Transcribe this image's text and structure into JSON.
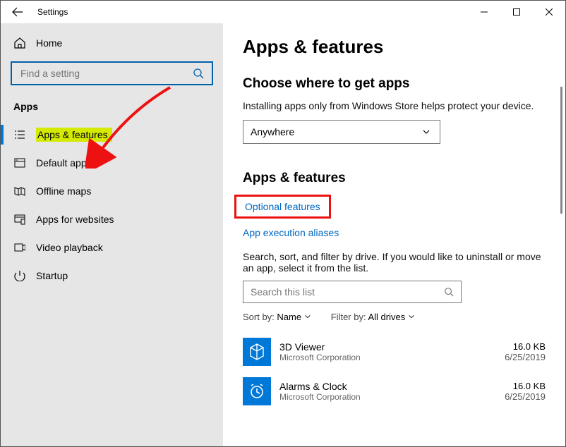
{
  "window": {
    "title": "Settings"
  },
  "sidebar": {
    "home": "Home",
    "search_placeholder": "Find a setting",
    "section": "Apps",
    "items": [
      {
        "label": "Apps & features"
      },
      {
        "label": "Default apps"
      },
      {
        "label": "Offline maps"
      },
      {
        "label": "Apps for websites"
      },
      {
        "label": "Video playback"
      },
      {
        "label": "Startup"
      }
    ]
  },
  "main": {
    "title": "Apps & features",
    "choose": {
      "heading": "Choose where to get apps",
      "help": "Installing apps only from Windows Store helps protect your device.",
      "selected": "Anywhere"
    },
    "subheading": "Apps & features",
    "optional_features": "Optional features",
    "exec_aliases": "App execution aliases",
    "desc": "Search, sort, and filter by drive. If you would like to uninstall or move an app, select it from the list.",
    "search_placeholder": "Search this list",
    "sort": {
      "label": "Sort by:",
      "value": "Name"
    },
    "filter": {
      "label": "Filter by:",
      "value": "All drives"
    },
    "apps": [
      {
        "name": "3D Viewer",
        "publisher": "Microsoft Corporation",
        "size": "16.0 KB",
        "date": "6/25/2019",
        "icon": "cube"
      },
      {
        "name": "Alarms & Clock",
        "publisher": "Microsoft Corporation",
        "size": "16.0 KB",
        "date": "6/25/2019",
        "icon": "clock"
      }
    ]
  }
}
